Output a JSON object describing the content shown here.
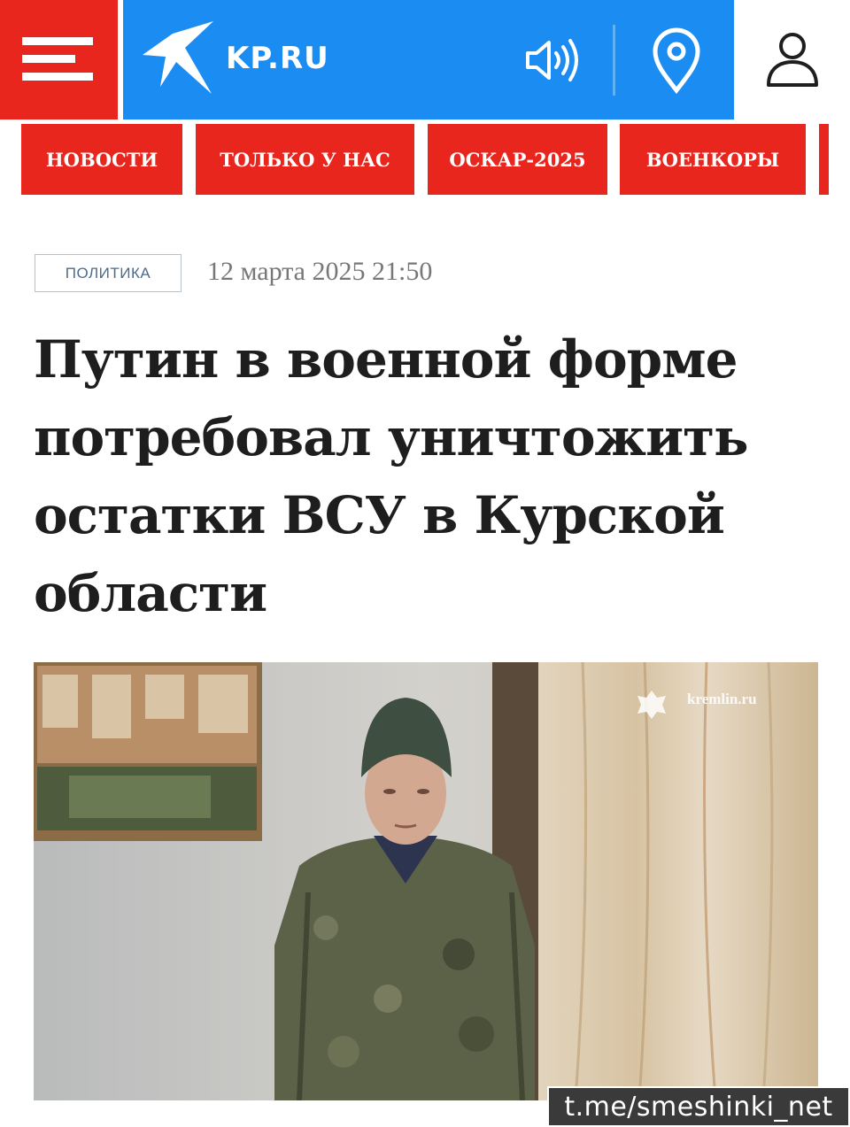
{
  "header": {
    "logo_text": "KP.RU",
    "brand_color": "#1b8df2",
    "accent_color": "#e8261e",
    "icons": [
      "menu-icon",
      "kp-bird-logo",
      "sound-icon",
      "location-pin-icon",
      "user-icon"
    ]
  },
  "nav": {
    "items": [
      {
        "label": "НОВОСТИ"
      },
      {
        "label": "ТОЛЬКО У НАС"
      },
      {
        "label": "ОСКАР-2025"
      },
      {
        "label": "ВОЕНКОРЫ"
      }
    ]
  },
  "article": {
    "category": "ПОЛИТИКА",
    "date": "12 марта 2025 21:50",
    "headline": "Путин в военной форме потребовал уничтожить остатки ВСУ в Курской области",
    "photo": {
      "watermark": "kremlin.ru"
    }
  },
  "channel_tag": "t.me/smeshinki_net"
}
